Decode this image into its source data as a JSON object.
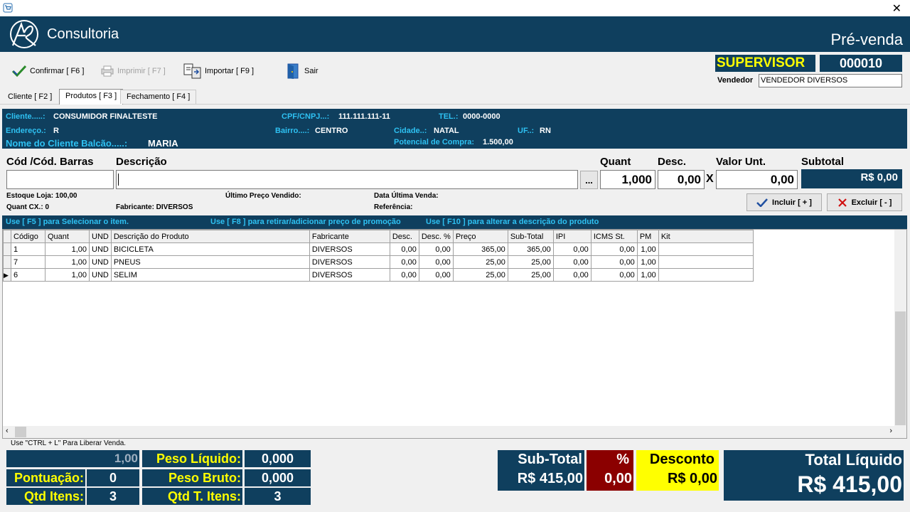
{
  "window": {
    "close_glyph": "✕"
  },
  "header": {
    "brand": "Consultoria",
    "title": "Pré-venda"
  },
  "toolbar": {
    "confirm": "Confirmar [ F6 ]",
    "print": "Imprimir  [ F7 ]",
    "import": "Importar [ F9 ]",
    "exit": "Sair"
  },
  "user": {
    "role": "SUPERVISOR",
    "code": "000010",
    "vendedor_label": "Vendedor",
    "vendedor_value": "VENDEDOR DIVERSOS"
  },
  "tabs": [
    "Cliente [ F2 ]",
    "Produtos [ F3 ]",
    "Fechamento [ F4 ]"
  ],
  "client": {
    "cliente_label": "Cliente.....:",
    "cliente_value": "CONSUMIDOR FINALTESTE",
    "cpf_label": "CPF/CNPJ...:",
    "cpf_value": "111.111.111-11",
    "tel_label": "TEL.:",
    "tel_value": "0000-0000",
    "endereco_label": "Endereço.:",
    "endereco_value": "R",
    "bairro_label": "Bairro....:",
    "bairro_value": "CENTRO",
    "cidade_label": "Cidade..:",
    "cidade_value": "NATAL",
    "uf_label": "UF..:",
    "uf_value": "RN",
    "balcao_label": "Nome do Cliente Balcão.....:",
    "balcao_value": "MARIA",
    "potencial_label": "Potencial de Compra:",
    "potencial_value": "1.500,00"
  },
  "entry": {
    "cod_label": "Cód /Cód. Barras",
    "desc_label": "Descrição",
    "quant_label": "Quant",
    "quant_value": "1,000",
    "descto_label": "Desc.",
    "descto_value": "0,00",
    "x": "X",
    "valor_label": "Valor Unt.",
    "valor_value": "0,00",
    "subtotal_label": "Subtotal",
    "subtotal_value": "R$ 0,00",
    "ellipsis": "..."
  },
  "info": {
    "estoque": "Estoque Loja: 100,00",
    "quantcx": "Quant CX.: 0",
    "fabricante": "Fabricante: DIVERSOS",
    "ultimo_preco": "Último Preço Vendido:",
    "data_ultima": "Data Última Venda:",
    "referencia": "Referência:"
  },
  "buttons": {
    "incluir": "Incluir [ + ]",
    "excluir": "Excluir [ - ]"
  },
  "hints": {
    "f5": "Use [ F5 ] para Selecionar o item.",
    "f8": "Use [ F8 ] para retirar/adicionar preço de promoção",
    "f10": "Use [ F10 ] para alterar a descrição do produto"
  },
  "table": {
    "columns": [
      "Código",
      "Quant",
      "UND",
      "Descrição do Produto",
      "Fabricante",
      "Desc.",
      "Desc. %",
      "Preço",
      "Sub-Total",
      "IPI",
      "ICMS St.",
      "PM",
      "Kit"
    ],
    "rows": [
      [
        "1",
        "1,00",
        "UND",
        "BICICLETA",
        "DIVERSOS",
        "0,00",
        "0,00",
        "365,00",
        "365,00",
        "0,00",
        "0,00",
        "1,00",
        ""
      ],
      [
        "7",
        "1,00",
        "UND",
        "PNEUS",
        "DIVERSOS",
        "0,00",
        "0,00",
        "25,00",
        "25,00",
        "0,00",
        "0,00",
        "1,00",
        ""
      ],
      [
        "6",
        "1,00",
        "UND",
        "SELIM",
        "DIVERSOS",
        "0,00",
        "0,00",
        "25,00",
        "25,00",
        "0,00",
        "0,00",
        "1,00",
        ""
      ]
    ],
    "selected_row": 2
  },
  "footnote": "Use \"CTRL + L\" Para Liberar Venda.",
  "footer": {
    "top_left_value": "1,00",
    "pontuacao_label": "Pontuação:",
    "pontuacao_value": "0",
    "qtd_itens_label": "Qtd Itens:",
    "qtd_itens_value": "3",
    "peso_liquido_label": "Peso Líquido:",
    "peso_liquido_value": "0,000",
    "peso_bruto_label": "Peso Bruto:",
    "peso_bruto_value": "0,000",
    "qtd_t_itens_label": "Qtd T. Itens:",
    "qtd_t_itens_value": "3",
    "subtotal_label": "Sub-Total",
    "subtotal_value": "R$ 415,00",
    "pct_label": "%",
    "pct_value": "0,00",
    "desconto_label": "Desconto",
    "desconto_value": "R$ 0,00",
    "total_label": "Total Líquido",
    "total_value": "R$ 415,00"
  },
  "colors": {
    "navy": "#0f3f5e",
    "cyan": "#2ec1f2",
    "yellow": "#ffff00",
    "darkred": "#8b0000"
  }
}
